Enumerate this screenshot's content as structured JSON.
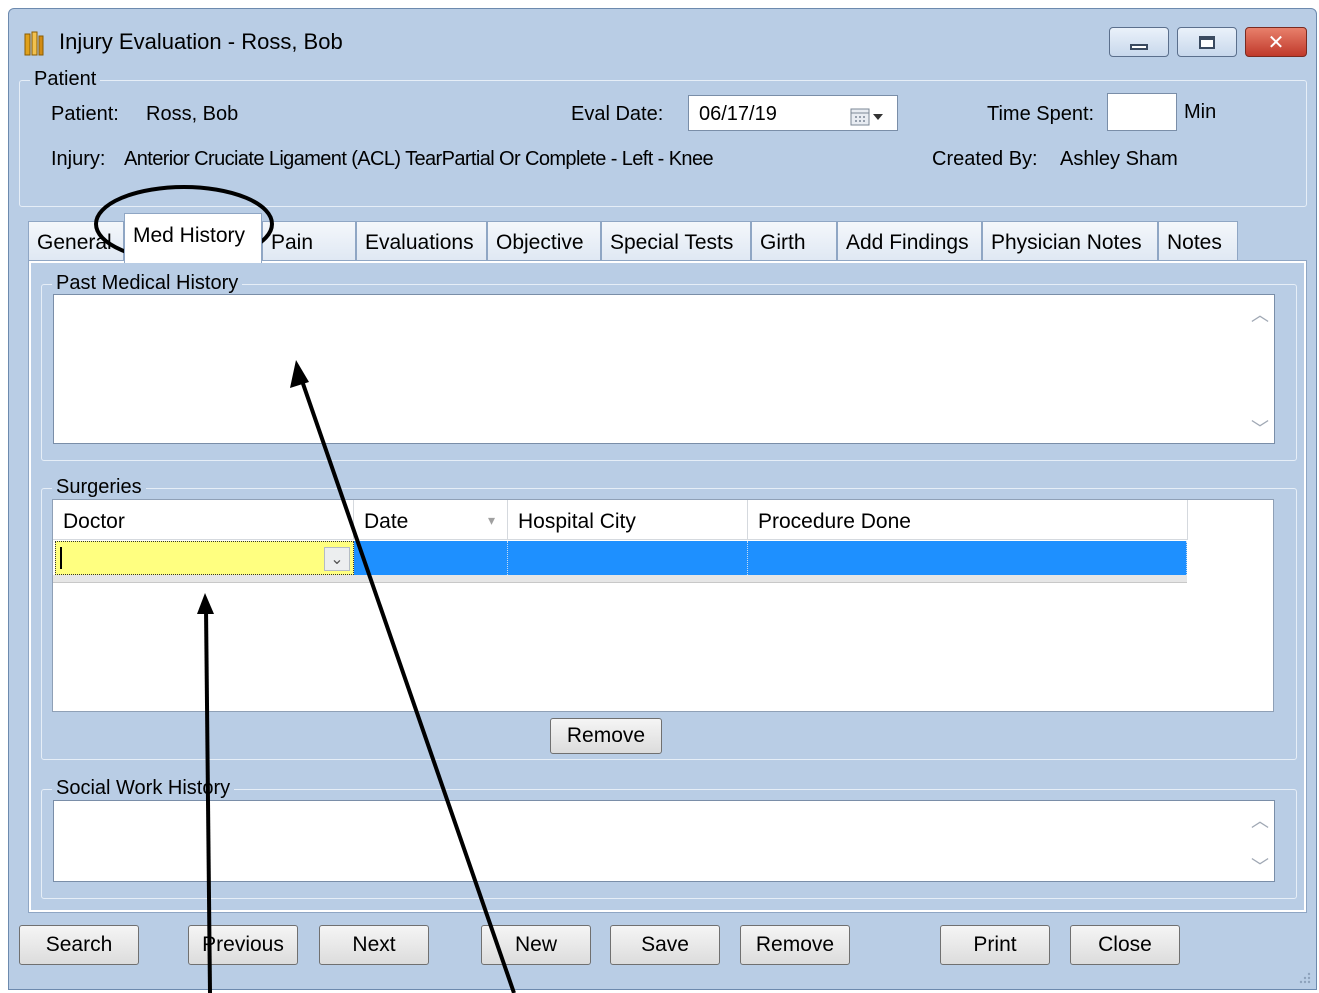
{
  "window": {
    "title": "Injury Evaluation - Ross, Bob",
    "controls": {
      "minimize": "minimize-icon",
      "maximize": "maximize-icon",
      "close": "close-icon"
    }
  },
  "patient_group": {
    "legend": "Patient",
    "patient_label": "Patient:",
    "patient_value": "Ross, Bob",
    "eval_date_label": "Eval Date:",
    "eval_date_value": "06/17/19",
    "time_spent_label": "Time Spent:",
    "time_spent_value": "",
    "time_unit": "Min",
    "injury_label": "Injury:",
    "injury_value": "Anterior Cruciate Ligament (ACL) TearPartial Or Complete - Left - Knee",
    "created_by_label": "Created By:",
    "created_by_value": "Ashley Sham"
  },
  "tabs": [
    {
      "label": "General"
    },
    {
      "label": "Med History",
      "active": true
    },
    {
      "label": "Pain"
    },
    {
      "label": "Evaluations"
    },
    {
      "label": "Objective"
    },
    {
      "label": "Special Tests"
    },
    {
      "label": "Girth"
    },
    {
      "label": "Add Findings"
    },
    {
      "label": "Physician Notes"
    },
    {
      "label": "Notes"
    }
  ],
  "med_history": {
    "past_medical_history": {
      "legend": "Past Medical History",
      "value": ""
    },
    "surgeries": {
      "legend": "Surgeries",
      "columns": [
        "Doctor",
        "Date",
        "Hospital City",
        "Procedure Done"
      ],
      "rows": [
        {
          "doctor": "",
          "date": "",
          "hospital_city": "",
          "procedure_done": ""
        }
      ],
      "remove_label": "Remove"
    },
    "social_work_history": {
      "legend": "Social Work History",
      "value": ""
    }
  },
  "footer_buttons": {
    "search": "Search",
    "previous": "Previous",
    "next": "Next",
    "new": "New",
    "save": "Save",
    "remove": "Remove",
    "print": "Print",
    "close": "Close"
  },
  "colors": {
    "window_bg": "#b9cde5",
    "selected_row": "#1e90ff",
    "editing_cell": "#ffff80",
    "close_button": "#c0392b"
  }
}
